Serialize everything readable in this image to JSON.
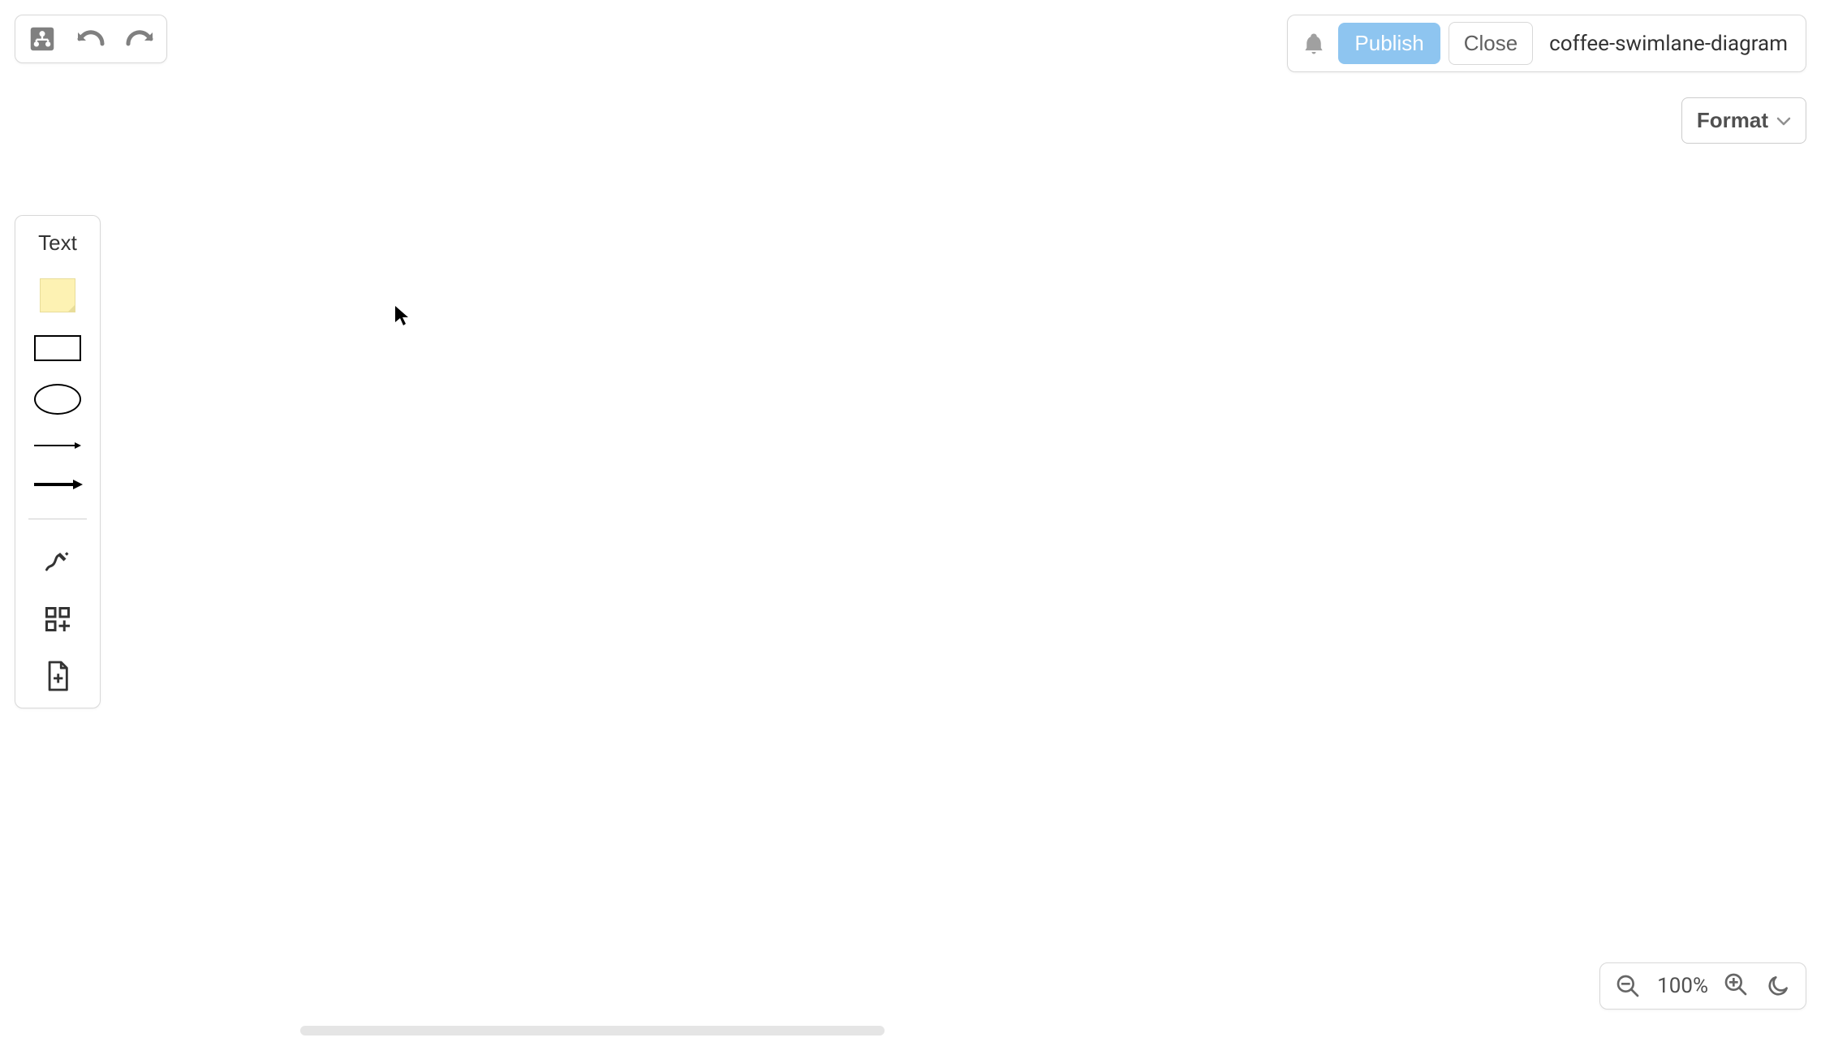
{
  "header": {
    "publish_label": "Publish",
    "close_label": "Close",
    "doc_title": "coffee-swimlane-diagram",
    "format_label": "Format"
  },
  "palette": {
    "text_label": "Text"
  },
  "zoom": {
    "level": "100%"
  }
}
